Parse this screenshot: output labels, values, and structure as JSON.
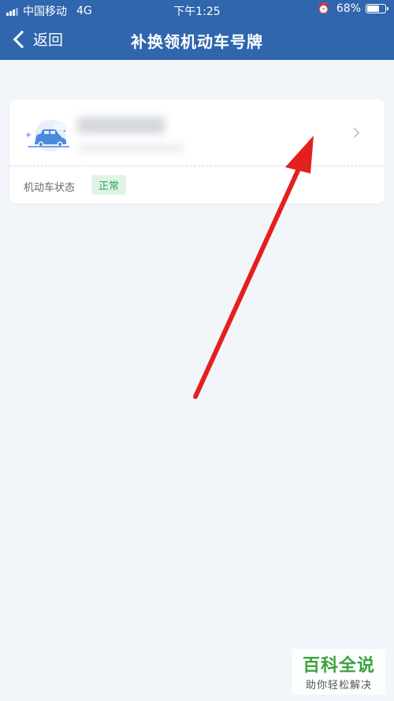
{
  "statusbar": {
    "carrier": "中国移动",
    "network": "4G",
    "time": "下午1:25",
    "battery_pct": "68%",
    "battery_level": 0.68
  },
  "nav": {
    "back_label": "返回",
    "title": "补换领机动车号牌"
  },
  "vehicle_card": {
    "status_label": "机动车状态",
    "status_value": "正常"
  },
  "watermark": {
    "main": "百科全说",
    "sub": "助你轻松解决"
  },
  "colors": {
    "header": "#2f66ad",
    "background": "#f2f5f9",
    "status_green": "#2ea462",
    "arrow_red": "#e31f1f"
  }
}
